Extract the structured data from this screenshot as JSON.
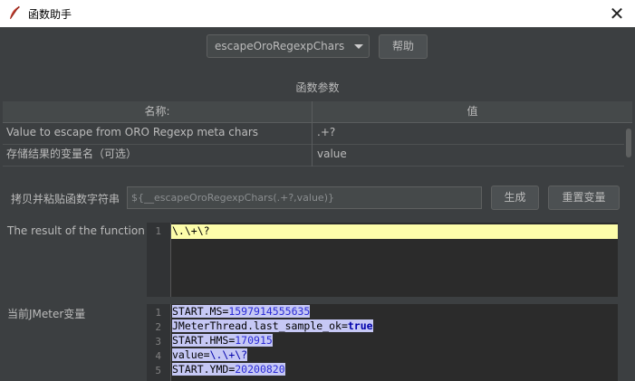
{
  "window": {
    "title": "函数助手"
  },
  "top": {
    "function_select": "escapeOroRegexpChars",
    "help_button": "帮助"
  },
  "params": {
    "section_title": "函数参数",
    "columns": [
      "名称:",
      "值"
    ],
    "rows": [
      {
        "name": "Value to escape from ORO Regexp meta chars",
        "value": ".+?"
      },
      {
        "name": "存储结果的变量名（可选）",
        "value": "value"
      }
    ]
  },
  "copy": {
    "label": "拷贝并粘贴函数字符串",
    "value": "${__escapeOroRegexpChars(.+?,value)}",
    "generate_button": "生成",
    "reset_button": "重置变量"
  },
  "result": {
    "label": "The result of the function is",
    "lines": [
      "\\.\\+\\?"
    ]
  },
  "vars": {
    "label": "当前JMeter变量",
    "lines": [
      {
        "key": "START.MS",
        "value": "1597914555635"
      },
      {
        "key": "JMeterThread.last_sample_ok",
        "value": "true"
      },
      {
        "key": "START.HMS",
        "value": "170915"
      },
      {
        "key": "value",
        "value": "\\.\\+\\?"
      },
      {
        "key": "START.YMD",
        "value": "20200820"
      }
    ]
  },
  "colors": {
    "background": "#3c3f41",
    "highlight": "#fdfdaa",
    "selection": "#c6c8f5"
  }
}
